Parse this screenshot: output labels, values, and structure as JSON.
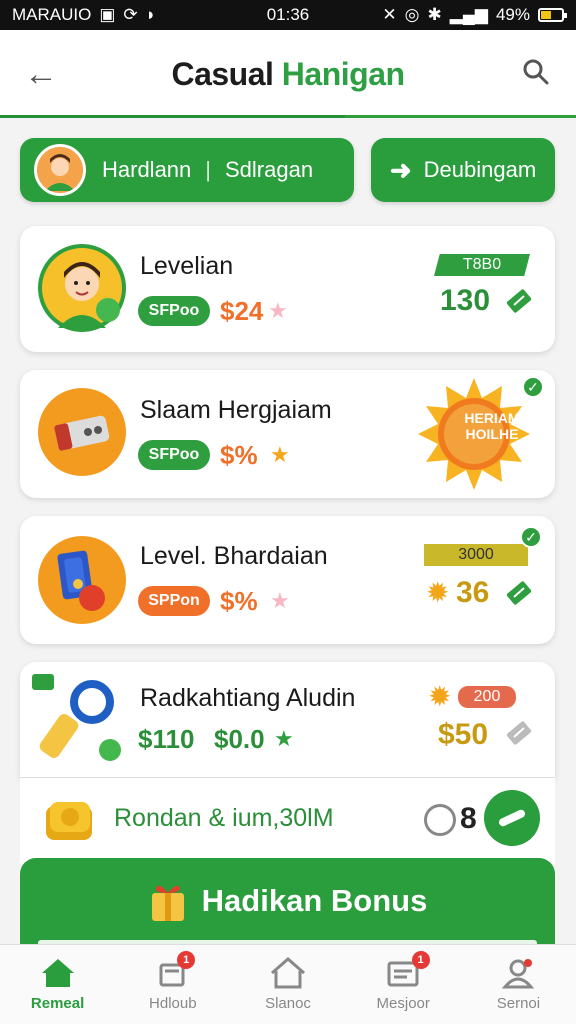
{
  "status_bar": {
    "carrier": "MARAUIO",
    "time": "01:36",
    "battery": "49%",
    "battery_level": 0.49
  },
  "header": {
    "title_part1": "Casual",
    "title_part2": "Hanigan",
    "back_icon": "arrow-left-icon",
    "search_icon": "search-icon"
  },
  "pills": {
    "left_label1": "Hardlann",
    "left_sep": "|",
    "left_label2": "Sdlragan",
    "right_label": "Deubingam"
  },
  "cards": [
    {
      "title": "Levelian",
      "tag": "SFPoo",
      "price": "$24",
      "badge": "T8B0",
      "amount": "130",
      "accent": "#2e9e3e"
    },
    {
      "title": "Slaam Hergjaiam",
      "tag": "SFPoo",
      "price": "$%",
      "badge_text": "HERIAM HOILHE"
    },
    {
      "title": "Level. Bhardaian",
      "tag": "SPPon",
      "price": "$%",
      "badge": "3000",
      "amount": "36"
    },
    {
      "title": "Radkahtiang Aludin",
      "price1": "$110",
      "price2": "$0.0",
      "badge": "200",
      "amount": "$50"
    }
  ],
  "bonus_row": {
    "text": "Rondan & ium,30lM",
    "count": "8"
  },
  "bonus_button": {
    "label": "Hadikan Bonus"
  },
  "nav": [
    {
      "label": "Remeal",
      "icon": "home-icon",
      "active": true
    },
    {
      "label": "Hdloub",
      "icon": "hat-icon",
      "badge": "1"
    },
    {
      "label": "Slanoc",
      "icon": "house-icon"
    },
    {
      "label": "Mesjoor",
      "icon": "inbox-icon",
      "badge": "1"
    },
    {
      "label": "Sernoi",
      "icon": "profile-icon"
    }
  ]
}
